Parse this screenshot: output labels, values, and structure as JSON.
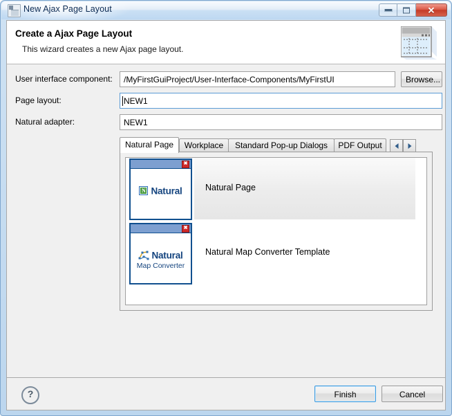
{
  "window": {
    "title": "New Ajax Page Layout",
    "icon": "ajax-page-layout-icon",
    "minimize_label": "",
    "maximize_label": "",
    "close_label": "✕"
  },
  "header": {
    "title": "Create a Ajax Page Layout",
    "subtitle": "This wizard creates a new Ajax page layout.",
    "banner_icon": "page-layout-banner-icon"
  },
  "form": {
    "fields": [
      {
        "label": "User interface component:",
        "value": "/MyFirstGuiProject/User-Interface-Components/MyFirstUI",
        "focused": false
      },
      {
        "label": "Page layout:",
        "value": "NEW1",
        "focused": true
      },
      {
        "label": "Natural adapter:",
        "value": "NEW1",
        "focused": false
      }
    ],
    "browse_label": "Browse..."
  },
  "tabs": {
    "items": [
      {
        "label": "Natural Page",
        "selected": true
      },
      {
        "label": "Workplace",
        "selected": false
      },
      {
        "label": "Standard Pop-up Dialogs",
        "selected": false
      },
      {
        "label": "PDF Output",
        "selected": false
      }
    ],
    "scroll_left_label": "◄",
    "scroll_right_label": "►"
  },
  "templates": [
    {
      "name": "Natural Page",
      "selected": true,
      "thumb_title": "Natural",
      "thumb_subtitle": "",
      "thumb_icon": "natural-logo-icon"
    },
    {
      "name": "Natural Map Converter Template",
      "selected": false,
      "thumb_title": "Natural",
      "thumb_subtitle": "Map Converter",
      "thumb_icon": "natural-map-converter-icon"
    }
  ],
  "footer": {
    "help_label": "?",
    "finish_label": "Finish",
    "cancel_label": "Cancel"
  },
  "colors": {
    "accent": "#11508f",
    "title_text": "#0c2b54",
    "thumb_bar": "#7d9fd0",
    "close_red": "#c43b28",
    "default_btn_border": "#3c9ade"
  }
}
